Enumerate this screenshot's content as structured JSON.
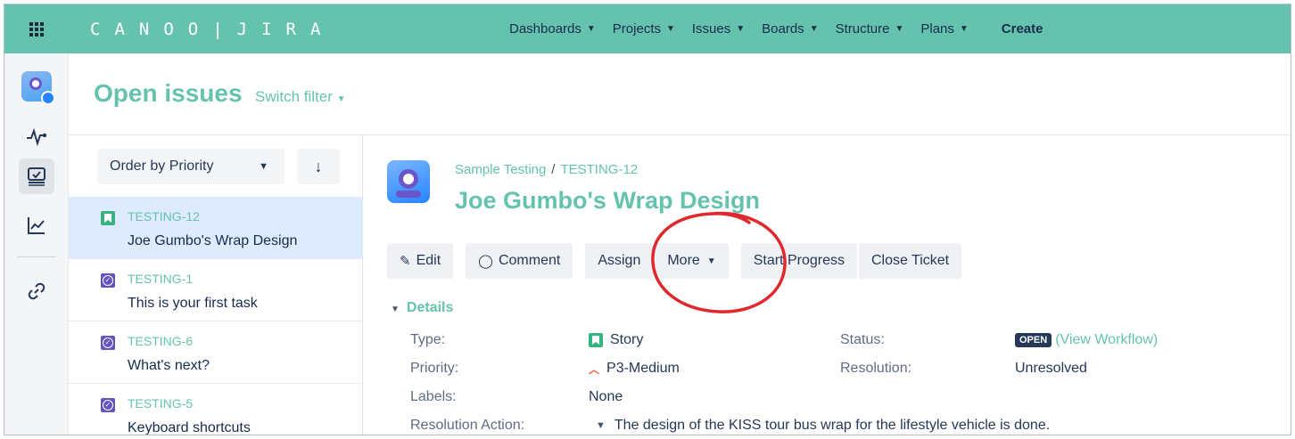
{
  "topnav": {
    "brand": "CANOO|JIRA",
    "items": [
      {
        "label": "Dashboards"
      },
      {
        "label": "Projects"
      },
      {
        "label": "Issues"
      },
      {
        "label": "Boards"
      },
      {
        "label": "Structure"
      },
      {
        "label": "Plans"
      }
    ],
    "create_label": "Create"
  },
  "rail": {
    "icons": [
      "project-avatar-icon",
      "activity-icon",
      "board-icon",
      "reports-icon",
      "link-icon"
    ]
  },
  "page": {
    "title": "Open issues",
    "switch_filter": "Switch filter"
  },
  "list": {
    "order_label": "Order by Priority",
    "sort_glyph": "↓",
    "issues": [
      {
        "key": "TESTING-12",
        "summary": "Joe Gumbo's Wrap Design",
        "type": "story",
        "selected": true
      },
      {
        "key": "TESTING-1",
        "summary": "This is your first task",
        "type": "task",
        "selected": false
      },
      {
        "key": "TESTING-6",
        "summary": "What's next?",
        "type": "task",
        "selected": false
      },
      {
        "key": "TESTING-5",
        "summary": "Keyboard shortcuts",
        "type": "task",
        "selected": false
      }
    ]
  },
  "detail": {
    "project": "Sample Testing",
    "separator": "/",
    "issue_key": "TESTING-12",
    "title": "Joe Gumbo's Wrap Design",
    "toolbar": {
      "edit": "Edit",
      "comment": "Comment",
      "assign": "Assign",
      "more": "More",
      "start_progress": "Start Progress",
      "close_ticket": "Close Ticket"
    },
    "details_label": "Details",
    "fields": {
      "type_label": "Type:",
      "type_value": "Story",
      "priority_label": "Priority:",
      "priority_value": "P3-Medium",
      "labels_label": "Labels:",
      "labels_value": "None",
      "resolution_action_label": "Resolution Action:",
      "resolution_action_value": "The design of the KISS tour bus wrap for the lifestyle vehicle is done.",
      "status_label": "Status:",
      "status_value": "OPEN",
      "view_workflow": "(View Workflow)",
      "resolution_label": "Resolution:",
      "resolution_value": "Unresolved"
    }
  },
  "colors": {
    "accent": "#65c3ad",
    "annotation": "#e0282d",
    "selected_row": "#deebff",
    "story": "#36b37e",
    "task": "#6554c0",
    "priority": "#ff5630"
  }
}
